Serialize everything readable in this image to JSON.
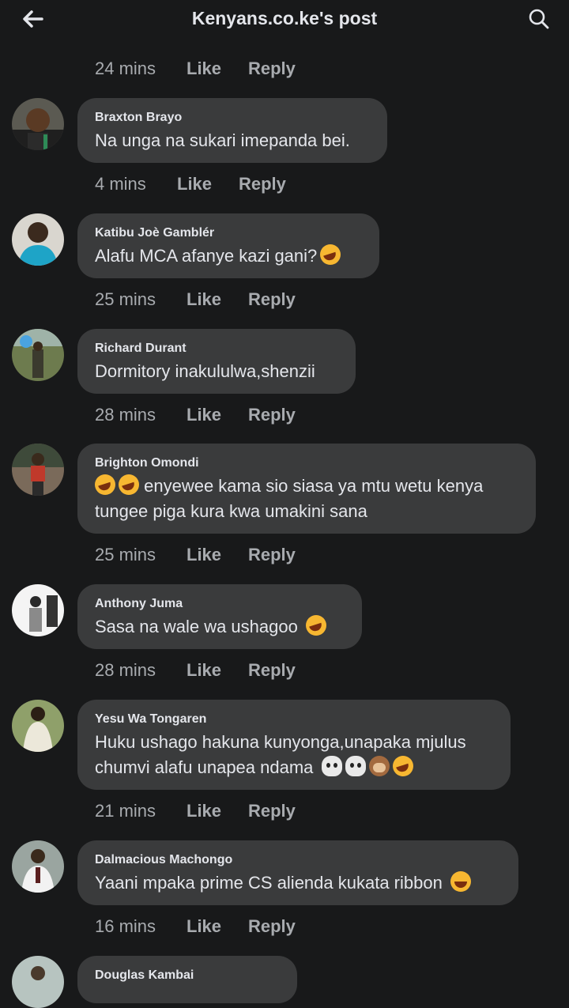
{
  "header": {
    "title": "Kenyans.co.ke's post",
    "back_icon": "arrow-left-icon",
    "search_icon": "search-icon"
  },
  "actions": {
    "like_label": "Like",
    "reply_label": "Reply"
  },
  "top_actions": {
    "time": "24 mins"
  },
  "comments": [
    {
      "author": "Braxton Brayo",
      "lines": [
        "Na unga na sukari imepanda bei."
      ],
      "time": "4 mins"
    },
    {
      "author": "Katibu Joè Gamblér",
      "lines": [
        "Alafu MCA afanye kazi gani?"
      ],
      "emoji_end": [
        "rofl"
      ],
      "time": "25 mins"
    },
    {
      "author": "Richard Durant",
      "lines": [
        "Dormitory inakululwa,shenzii"
      ],
      "time": "28 mins"
    },
    {
      "author": "Brighton Omondi",
      "emoji_start": [
        "rofl",
        "rofl"
      ],
      "lines": [
        "enyewee kama sio siasa ya mtu wetu kenya",
        "tungee piga kura kwa umakini sana"
      ],
      "time": "25 mins"
    },
    {
      "author": "Anthony Juma",
      "lines": [
        "Sasa na wale wa ushagoo"
      ],
      "emoji_end": [
        "rofl"
      ],
      "time": "28 mins"
    },
    {
      "author": "Yesu Wa Tongaren",
      "lines": [
        "Huku ushago hakuna kunyonga,unapaka mjulus",
        "chumvi alafu unapea ndama"
      ],
      "emoji_end": [
        "skull",
        "skull",
        "monkey",
        "rofl"
      ],
      "time": "21 mins"
    },
    {
      "author": "Dalmacious Machongo",
      "lines": [
        "Yaani mpaka prime CS alienda kukata ribbon"
      ],
      "emoji_end": [
        "joy"
      ],
      "time": "16 mins"
    },
    {
      "author": "Douglas Kambai",
      "lines": [],
      "time": ""
    }
  ],
  "colors": {
    "background": "#18191a",
    "bubble": "#3a3b3c",
    "text": "#e4e6eb",
    "meta": "#a8abaf"
  }
}
